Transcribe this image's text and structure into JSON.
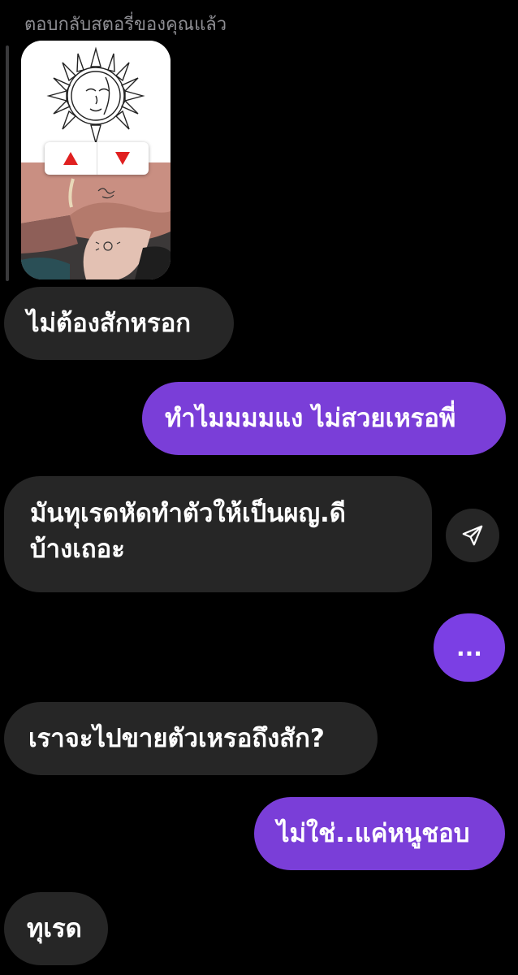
{
  "story_reply": {
    "label": "ตอบกลับสตอรี่ของคุณแล้ว",
    "thumbnail": "story-image-sun-tattoo",
    "poll_up_icon": "triangle-up-icon",
    "poll_down_icon": "triangle-down-icon"
  },
  "messages": [
    {
      "side": "in",
      "text": "ไม่ต้องสักหรอก"
    },
    {
      "side": "out",
      "text": "ทำไมมมมแง ไม่สวยเหรอพี่"
    },
    {
      "side": "in",
      "line1": "มันทุเรดหัดทำตัวให้เป็นผญ.ดี",
      "line2": "บ้างเถอะ"
    },
    {
      "side": "out",
      "text": "..."
    },
    {
      "side": "in",
      "text": "เราจะไปขายตัวเหรอถึงสัก?"
    },
    {
      "side": "out",
      "text": "ไม่ใช่..แค่หนูชอบ"
    },
    {
      "side": "in",
      "text": "ทุเรด"
    }
  ],
  "share_icon": "send-icon",
  "colors": {
    "background": "#000000",
    "incoming_bubble": "#262626",
    "outgoing_bubble": "#7a3ed8",
    "muted_text": "#8e8e93"
  }
}
